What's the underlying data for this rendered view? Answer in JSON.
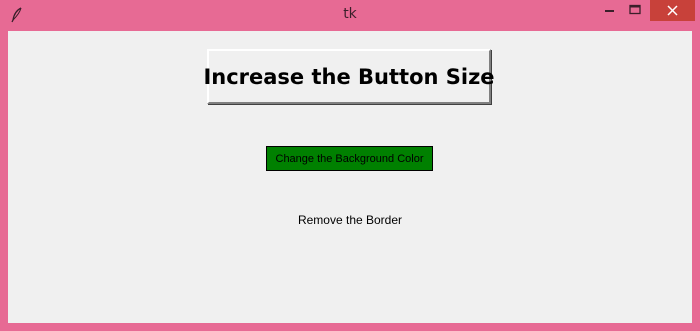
{
  "window": {
    "title": "tk",
    "icon": "feather-icon",
    "controls": [
      "minimize-icon",
      "maximize-icon",
      "close-icon"
    ],
    "frame_color": "#e76a94",
    "close_color": "#c8413a",
    "client_bg": "#f0f0f0"
  },
  "buttons": {
    "increase_size_label": "Increase the Button Size",
    "change_bg_label": "Change the Background Color",
    "change_bg_color": "#008000",
    "remove_border_label": "Remove the Border"
  }
}
